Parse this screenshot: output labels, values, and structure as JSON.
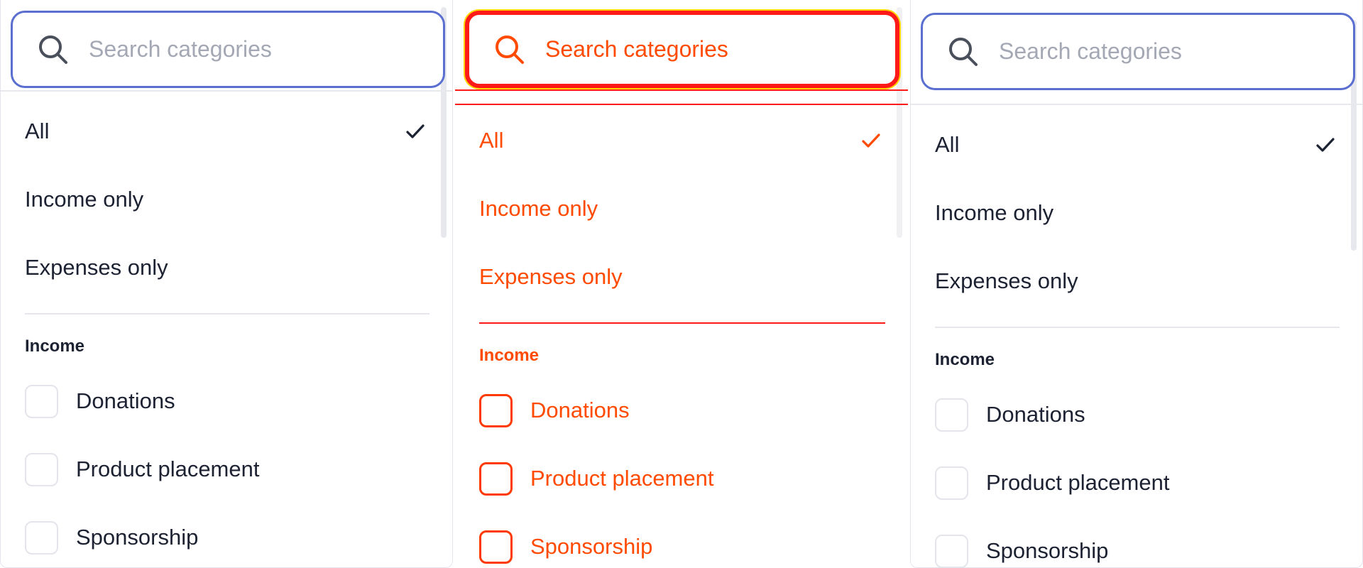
{
  "search": {
    "placeholder": "Search categories",
    "value": ""
  },
  "options": [
    {
      "label": "All",
      "selected": true
    },
    {
      "label": "Income only",
      "selected": false
    },
    {
      "label": "Expenses only",
      "selected": false
    }
  ],
  "group": {
    "heading": "Income",
    "items": [
      {
        "label": "Donations",
        "checked": false
      },
      {
        "label": "Product placement",
        "checked": false
      },
      {
        "label": "Sponsorship",
        "checked": false
      }
    ]
  },
  "colors": {
    "accent": "#5a6fd0",
    "text": "#1d2233",
    "placeholder": "#a4a8b4",
    "border": "#e3e5ec",
    "highlight_red": "#ff1a1a",
    "highlight_orange": "#ff4a00",
    "highlight_yellow": "#ffd400"
  }
}
